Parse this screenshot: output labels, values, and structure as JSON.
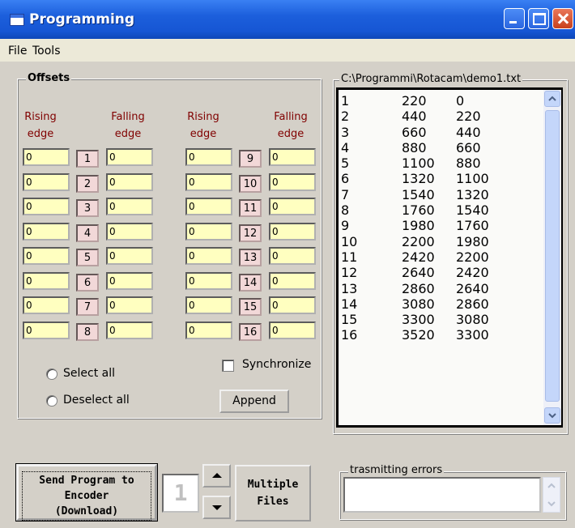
{
  "window": {
    "title": "Programming"
  },
  "menu": {
    "file": "File",
    "tools": "Tools"
  },
  "offsets": {
    "legend": "Offsets",
    "headers": {
      "rising": "Rising\nedge",
      "falling": "Falling\nedge"
    },
    "rising_label": "Rising",
    "falling_label": "Falling",
    "edge_label": "edge",
    "channels": [
      {
        "num": "1",
        "rising": "0",
        "falling": "0"
      },
      {
        "num": "2",
        "rising": "0",
        "falling": "0"
      },
      {
        "num": "3",
        "rising": "0",
        "falling": "0"
      },
      {
        "num": "4",
        "rising": "0",
        "falling": "0"
      },
      {
        "num": "5",
        "rising": "0",
        "falling": "0"
      },
      {
        "num": "6",
        "rising": "0",
        "falling": "0"
      },
      {
        "num": "7",
        "rising": "0",
        "falling": "0"
      },
      {
        "num": "8",
        "rising": "0",
        "falling": "0"
      },
      {
        "num": "9",
        "rising": "0",
        "falling": "0"
      },
      {
        "num": "10",
        "rising": "0",
        "falling": "0"
      },
      {
        "num": "11",
        "rising": "0",
        "falling": "0"
      },
      {
        "num": "12",
        "rising": "0",
        "falling": "0"
      },
      {
        "num": "13",
        "rising": "0",
        "falling": "0"
      },
      {
        "num": "14",
        "rising": "0",
        "falling": "0"
      },
      {
        "num": "15",
        "rising": "0",
        "falling": "0"
      },
      {
        "num": "16",
        "rising": "0",
        "falling": "0"
      }
    ],
    "select_all": "Select all",
    "deselect_all": "Deselect all",
    "synchronize": "Synchronize",
    "append": "Append"
  },
  "file_panel": {
    "legend": "C:\\Programmi\\Rotacam\\demo1.txt",
    "rows": [
      [
        "1",
        "220",
        "0"
      ],
      [
        "2",
        "440",
        "220"
      ],
      [
        "3",
        "660",
        "440"
      ],
      [
        "4",
        "880",
        "660"
      ],
      [
        "5",
        "1100",
        "880"
      ],
      [
        "6",
        "1320",
        "1100"
      ],
      [
        "7",
        "1540",
        "1320"
      ],
      [
        "8",
        "1760",
        "1540"
      ],
      [
        "9",
        "1980",
        "1760"
      ],
      [
        "10",
        "2200",
        "1980"
      ],
      [
        "11",
        "2420",
        "2200"
      ],
      [
        "12",
        "2640",
        "2420"
      ],
      [
        "13",
        "2860",
        "2640"
      ],
      [
        "14",
        "3080",
        "2860"
      ],
      [
        "15",
        "3300",
        "3080"
      ],
      [
        "16",
        "3520",
        "3300"
      ]
    ]
  },
  "bottom": {
    "send_line1": "Send Program to",
    "send_line2": "Encoder",
    "send_line3": "(Download)",
    "counter_value": "1",
    "multiple_line1": "Multiple",
    "multiple_line2": "Files",
    "errors_legend": "trasmitting errors",
    "errors_value": ""
  }
}
